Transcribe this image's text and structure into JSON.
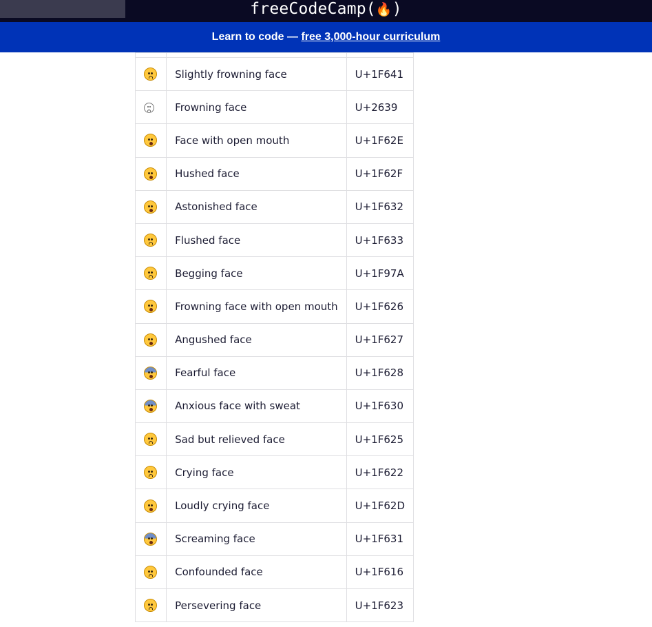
{
  "header": {
    "logo_text": "freeCodeCamp(",
    "logo_flame": "🔥",
    "logo_close": ")"
  },
  "banner": {
    "prefix": "Learn to code — ",
    "link": "free 3,000-hour curriculum"
  },
  "colors": {
    "topbar": "#0a0a23",
    "banner": "#0033b7",
    "text": "#1b1b32",
    "border": "#dfdfe2"
  },
  "rows": [
    {
      "icon": "slightly-frowning-face-icon",
      "name": "Slightly frowning face",
      "code": "U+1F641"
    },
    {
      "icon": "frowning-face-icon",
      "name": "Frowning face",
      "code": "U+2639"
    },
    {
      "icon": "face-with-open-mouth-icon",
      "name": "Face with open mouth",
      "code": "U+1F62E"
    },
    {
      "icon": "hushed-face-icon",
      "name": "Hushed face",
      "code": "U+1F62F"
    },
    {
      "icon": "astonished-face-icon",
      "name": "Astonished face",
      "code": "U+1F632"
    },
    {
      "icon": "flushed-face-icon",
      "name": "Flushed face",
      "code": "U+1F633"
    },
    {
      "icon": "begging-face-icon",
      "name": "Begging face",
      "code": "U+1F97A"
    },
    {
      "icon": "frowning-face-with-open-mouth-icon",
      "name": "Frowning face with open mouth",
      "code": "U+1F626"
    },
    {
      "icon": "anguished-face-icon",
      "name": "Angushed face",
      "code": "U+1F627"
    },
    {
      "icon": "fearful-face-icon",
      "name": "Fearful face",
      "code": "U+1F628"
    },
    {
      "icon": "anxious-face-with-sweat-icon",
      "name": "Anxious face with sweat",
      "code": "U+1F630"
    },
    {
      "icon": "sad-but-relieved-face-icon",
      "name": "Sad but relieved face",
      "code": "U+1F625"
    },
    {
      "icon": "crying-face-icon",
      "name": "Crying face",
      "code": "U+1F622"
    },
    {
      "icon": "loudly-crying-face-icon",
      "name": "Loudly crying face",
      "code": "U+1F62D"
    },
    {
      "icon": "screaming-face-icon",
      "name": "Screaming face",
      "code": "U+1F631"
    },
    {
      "icon": "confounded-face-icon",
      "name": "Confounded face",
      "code": "U+1F616"
    },
    {
      "icon": "persevering-face-icon",
      "name": "Persevering face",
      "code": "U+1F623"
    }
  ]
}
